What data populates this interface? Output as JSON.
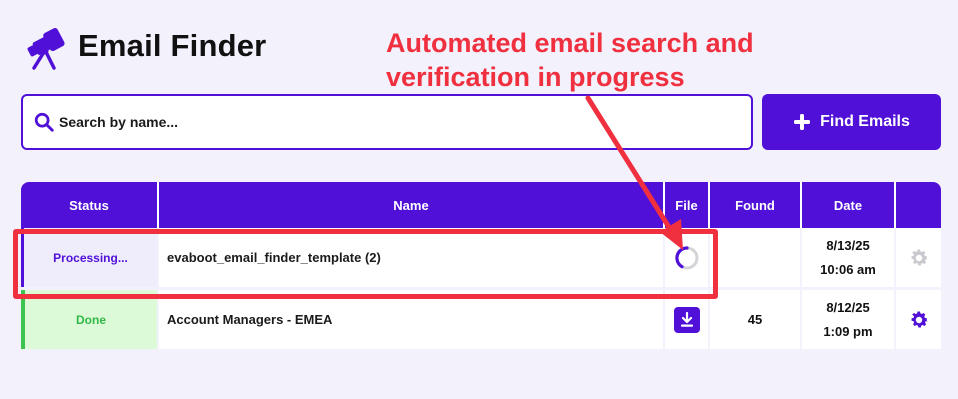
{
  "header": {
    "title": "Email Finder",
    "logo_icon": "telescope-icon"
  },
  "annotation": {
    "text": "Automated email search and verification in progress",
    "color": "#f0303f"
  },
  "search": {
    "placeholder": "Search by name...",
    "value": ""
  },
  "find_button": {
    "label": "Find Emails",
    "icon": "plus-icon"
  },
  "colors": {
    "accent": "#5010d8",
    "done": "#3bc44e",
    "annotation": "#f0303f"
  },
  "table": {
    "columns": [
      "Status",
      "Name",
      "File",
      "Found",
      "Date"
    ],
    "rows": [
      {
        "status": "Processing...",
        "name": "evaboot_email_finder_template (2)",
        "file": "spinner-icon",
        "found": "",
        "date": "8/13/25",
        "time": "10:06 am",
        "action": "gear-icon-disabled"
      },
      {
        "status": "Done",
        "name": "Account Managers - EMEA",
        "file": "download-icon",
        "found": "45",
        "date": "8/12/25",
        "time": "1:09 pm",
        "action": "gear-icon"
      }
    ]
  }
}
